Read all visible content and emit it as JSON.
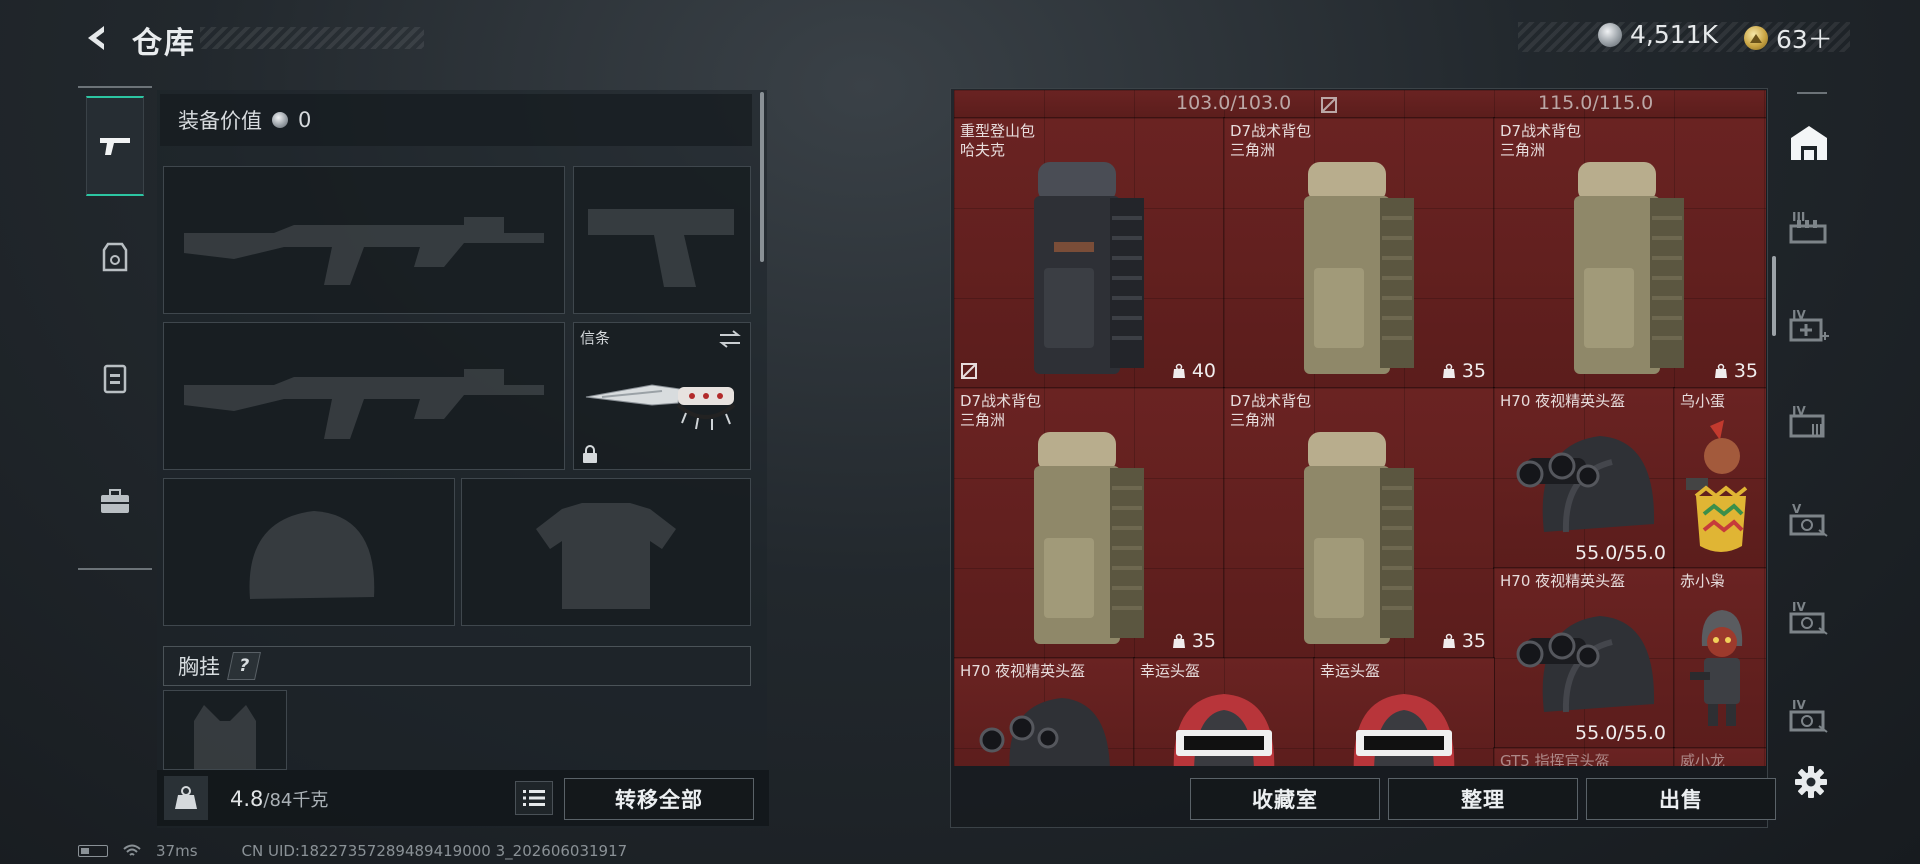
{
  "header": {
    "title": "仓库",
    "currencies": [
      {
        "icon": "silver-coin-icon",
        "value": "4,511K"
      },
      {
        "icon": "gold-coin-icon",
        "value": "63＋"
      }
    ]
  },
  "categories": [
    {
      "name": "weapons",
      "icon": "gun-icon",
      "active": true
    },
    {
      "name": "armor",
      "icon": "armor-vest-icon",
      "active": false
    },
    {
      "name": "backpack",
      "icon": "backpack-icon",
      "active": false
    },
    {
      "name": "briefcase",
      "icon": "briefcase-icon",
      "active": false
    }
  ],
  "equipment": {
    "value_label": "装备价值",
    "value": "0",
    "knife_label": "信条",
    "chest_label": "胸挂",
    "chest_help": "?",
    "weight_value": "4.8",
    "weight_max": "/84千克",
    "transfer_all": "转移全部"
  },
  "inventory": {
    "top_caps": [
      "103.0/103.0",
      "115.0/115.0"
    ],
    "items": [
      {
        "line1": "重型登山包",
        "line2": "哈夫克",
        "capacity": "40",
        "color": "dark"
      },
      {
        "line1": "D7战术背包",
        "line2": "三角洲",
        "capacity": "35",
        "color": "tan"
      },
      {
        "line1": "D7战术背包",
        "line2": "三角洲",
        "capacity": "35",
        "color": "tan"
      },
      {
        "line1": "D7战术背包",
        "line2": "三角洲",
        "capacity": "35",
        "color": "tan"
      },
      {
        "line1": "D7战术背包",
        "line2": "三角洲",
        "capacity": "35",
        "color": "tan"
      },
      {
        "line1": "H70 夜视精英头盔",
        "line2": "",
        "durability": "55.0/55.0"
      },
      {
        "line1": "乌小蛋",
        "line2": ""
      },
      {
        "line1": "H70 夜视精英头盔",
        "line2": "",
        "durability": "55.0/55.0"
      },
      {
        "line1": "赤小枭",
        "line2": ""
      },
      {
        "line1": "H70 夜视精英头盔",
        "line2": ""
      },
      {
        "line1": "幸运头盔",
        "line2": ""
      },
      {
        "line1": "幸运头盔",
        "line2": ""
      },
      {
        "line1": "GT5 指挥官头盔",
        "line2": ""
      },
      {
        "line1": "威小龙",
        "line2": ""
      }
    ],
    "buttons": {
      "collection": "收藏室",
      "sort": "整理",
      "sell": "出售"
    }
  },
  "side_tabs": [
    {
      "icon": "storehouse-icon",
      "roman": ""
    },
    {
      "icon": "ammo-crate-icon",
      "roman": "III"
    },
    {
      "icon": "medical-case-icon",
      "roman": "IV"
    },
    {
      "icon": "equipment-case-icon",
      "roman": "IV"
    },
    {
      "icon": "gun-case-icon",
      "roman": "V"
    },
    {
      "icon": "gun-case-icon",
      "roman": "IV"
    },
    {
      "icon": "gun-case-icon",
      "roman": "IV"
    }
  ],
  "status": {
    "ping": "37ms",
    "uid": "CN UID:18227357289489419000 3_202606031917"
  }
}
